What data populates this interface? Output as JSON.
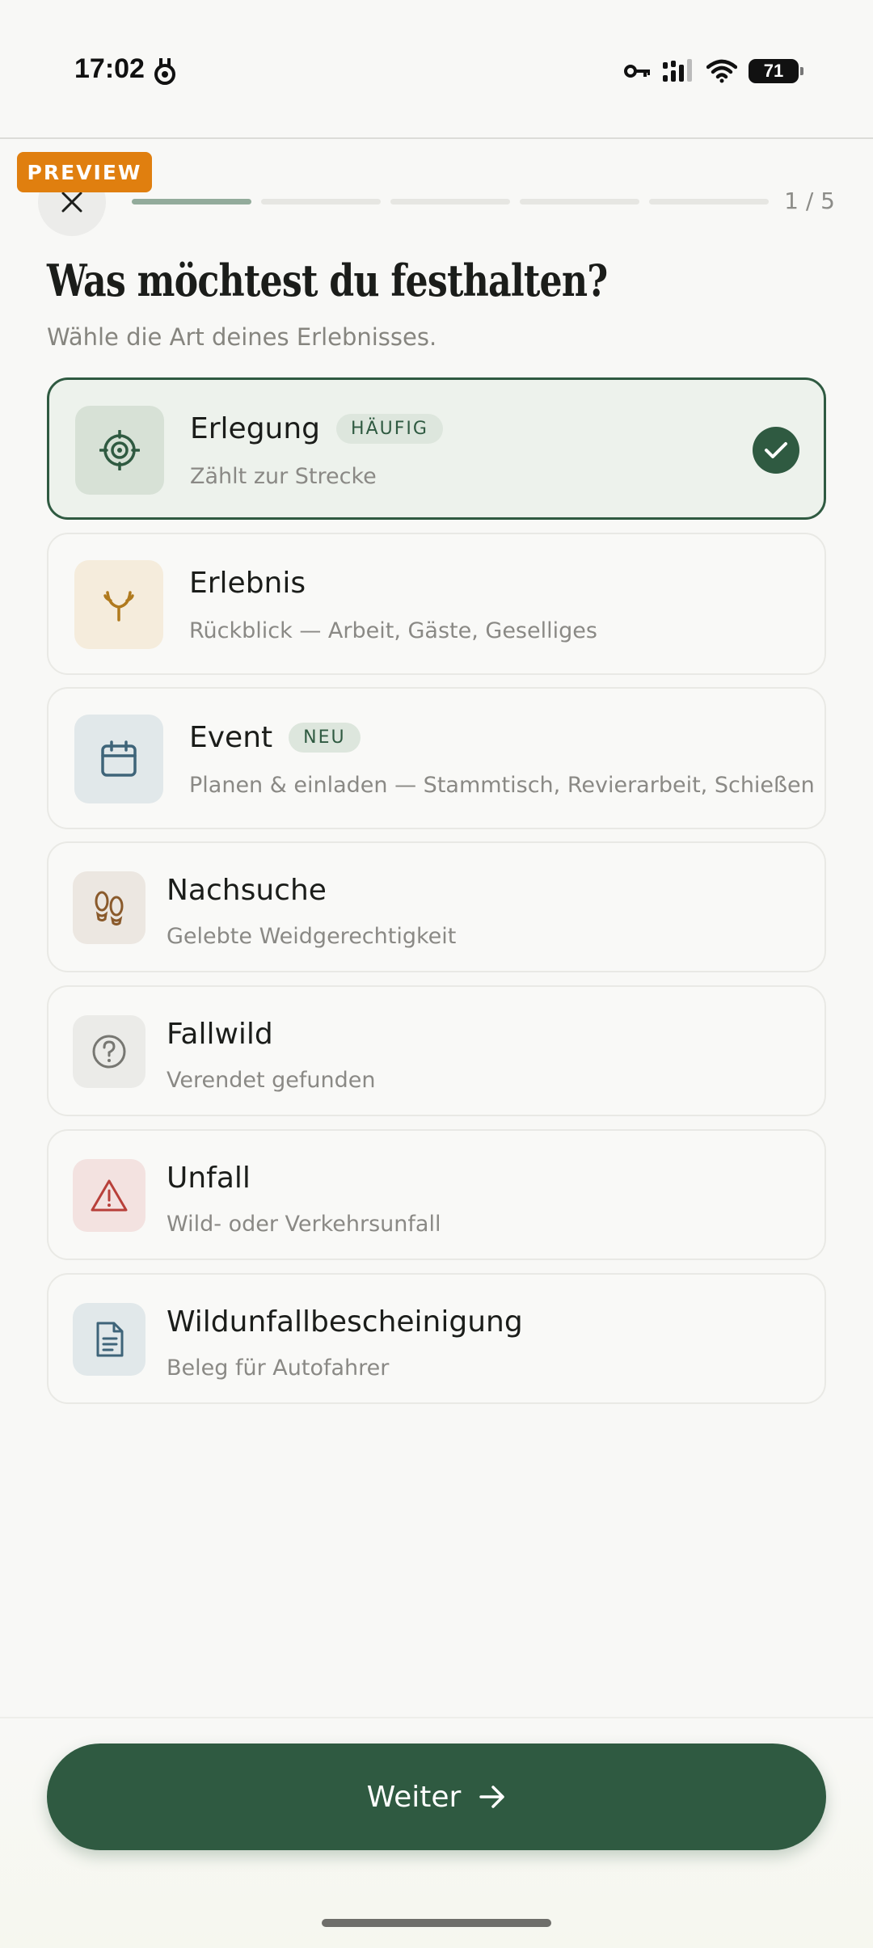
{
  "status_bar": {
    "time": "17:02",
    "battery": "71",
    "icons": [
      "app-notification-icon",
      "key-icon",
      "signal-icon",
      "wifi-icon",
      "battery-icon"
    ]
  },
  "preview_badge": "PREVIEW",
  "header": {
    "close_icon": "close-icon",
    "progress": {
      "current": 1,
      "total": 5
    },
    "step_label": "1 / 5"
  },
  "title": "Was möchtest du festhalten?",
  "subtitle": "Wähle die Art deines Erlebnisses.",
  "options": [
    {
      "name": "Erlegung",
      "badge": "HÄUFIG",
      "description": "Zählt zur Strecke",
      "icon": "target-icon",
      "selected": true,
      "accent": "#2f5a41"
    },
    {
      "name": "Erlebnis",
      "description": "Rückblick — Arbeit, Gäste, Geselliges",
      "icon": "antler-icon",
      "selected": false,
      "accent": "#b07a1e"
    },
    {
      "name": "Event",
      "badge": "NEU",
      "description": "Planen & einladen — Stammtisch, Revierarbeit, Schießen",
      "icon": "calendar-icon",
      "selected": false,
      "accent": "#3e6479"
    },
    {
      "name": "Nachsuche",
      "description": "Gelebte Weidgerechtigkeit",
      "icon": "footprints-icon",
      "selected": false,
      "accent": "#8a5a2b"
    },
    {
      "name": "Fallwild",
      "description": "Verendet gefunden",
      "icon": "question-circle-icon",
      "selected": false,
      "accent": "#777772"
    },
    {
      "name": "Unfall",
      "description": "Wild- oder Verkehrsunfall",
      "icon": "warning-triangle-icon",
      "selected": false,
      "accent": "#b8403a"
    },
    {
      "name": "Wildunfallbescheinigung",
      "description": "Beleg für Autofahrer",
      "icon": "document-icon",
      "selected": false,
      "accent": "#3e6479"
    }
  ],
  "footer": {
    "continue_label": "Weiter",
    "continue_icon": "arrow-right-icon"
  },
  "colors": {
    "primary": "#2f5a41",
    "preview_badge": "#e07f0f",
    "background": "#f8f8f6"
  }
}
